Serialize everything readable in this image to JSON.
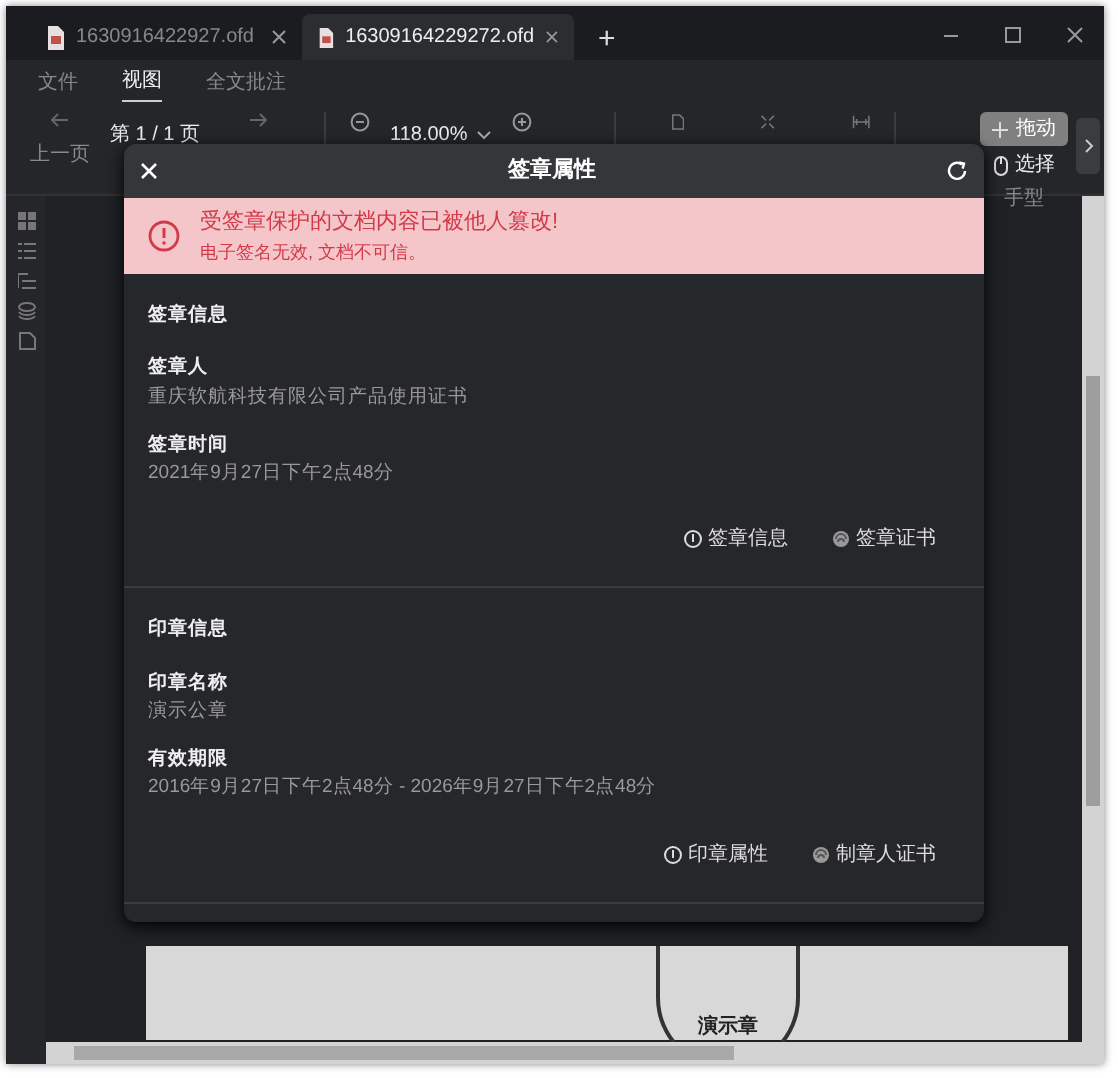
{
  "tabs": [
    {
      "title": "1630916422927.ofd",
      "selected": false
    },
    {
      "title": "16309164229272.ofd",
      "selected": true
    }
  ],
  "new_tab": "+",
  "menu": [
    {
      "label": "文件",
      "selected": false
    },
    {
      "label": "视图",
      "selected": true
    },
    {
      "label": "全文批注",
      "selected": false
    }
  ],
  "toolbar": {
    "prev_label": "上一页",
    "page": "第 1 / 1 页",
    "zoom": "118.00%",
    "modes": [
      {
        "label": "拖动",
        "selected": true
      },
      {
        "label": "选择",
        "selected": false
      }
    ],
    "mode_caption": "手型"
  },
  "document": {
    "stamp_text": "演示章"
  },
  "dialog": {
    "title": "签章属性",
    "alert": {
      "title": "受签章保护的文档内容已被他人篡改!",
      "message": "电子签名无效, 文档不可信。"
    },
    "sections": [
      {
        "heading": "签章信息",
        "fields": [
          {
            "label": "签章人",
            "value": "重庆软航科技有限公司产品使用证书"
          },
          {
            "label": "签章时间",
            "value": "2021年9月27日下午2点48分"
          }
        ],
        "actions": [
          {
            "kind": "info",
            "label": "签章信息"
          },
          {
            "kind": "certificate",
            "label": "签章证书"
          }
        ]
      },
      {
        "heading": "印章信息",
        "fields": [
          {
            "label": "印章名称",
            "value": "演示公章"
          },
          {
            "label": "有效期限",
            "value": "2016年9月27日下午2点48分 - 2026年9月27日下午2点48分"
          }
        ],
        "actions": [
          {
            "kind": "info",
            "label": "印章属性"
          },
          {
            "kind": "certificate",
            "label": "制章人证书"
          }
        ]
      }
    ]
  }
}
